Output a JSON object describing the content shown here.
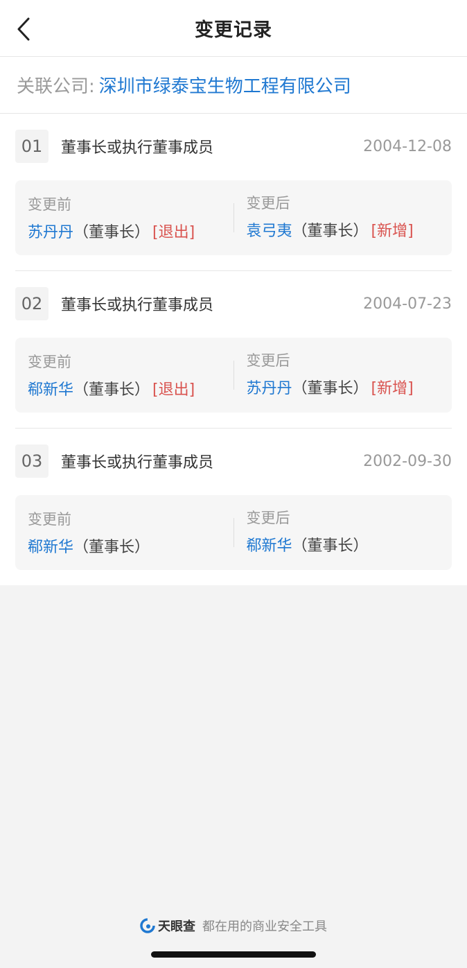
{
  "header": {
    "title": "变更记录"
  },
  "company": {
    "label": "关联公司:",
    "name": "深圳市绿泰宝生物工程有限公司"
  },
  "records": [
    {
      "index": "01",
      "type": "董事长或执行董事成员",
      "date": "2004-12-08",
      "before_label": "变更前",
      "after_label": "变更后",
      "before": {
        "name": "苏丹丹",
        "role": "（董事长）",
        "tag": "[退出]"
      },
      "after": {
        "name": "袁弓夷",
        "role": "（董事长）",
        "tag": "[新增]"
      }
    },
    {
      "index": "02",
      "type": "董事长或执行董事成员",
      "date": "2004-07-23",
      "before_label": "变更前",
      "after_label": "变更后",
      "before": {
        "name": "郗新华",
        "role": "（董事长）",
        "tag": "[退出]"
      },
      "after": {
        "name": "苏丹丹",
        "role": "（董事长）",
        "tag": "[新增]"
      }
    },
    {
      "index": "03",
      "type": "董事长或执行董事成员",
      "date": "2002-09-30",
      "before_label": "变更前",
      "after_label": "变更后",
      "before": {
        "name": "郗新华",
        "role": "（董事长）",
        "tag": ""
      },
      "after": {
        "name": "郗新华",
        "role": "（董事长）",
        "tag": ""
      }
    }
  ],
  "footer": {
    "brand": "天眼查",
    "slogan": "都在用的商业安全工具"
  },
  "colors": {
    "link": "#1f78d1",
    "tag": "#d9534f",
    "bg": "#f3f3f3"
  },
  "icons": {
    "back": "chevron-left-icon",
    "brand": "tianyancha-logo-icon"
  }
}
